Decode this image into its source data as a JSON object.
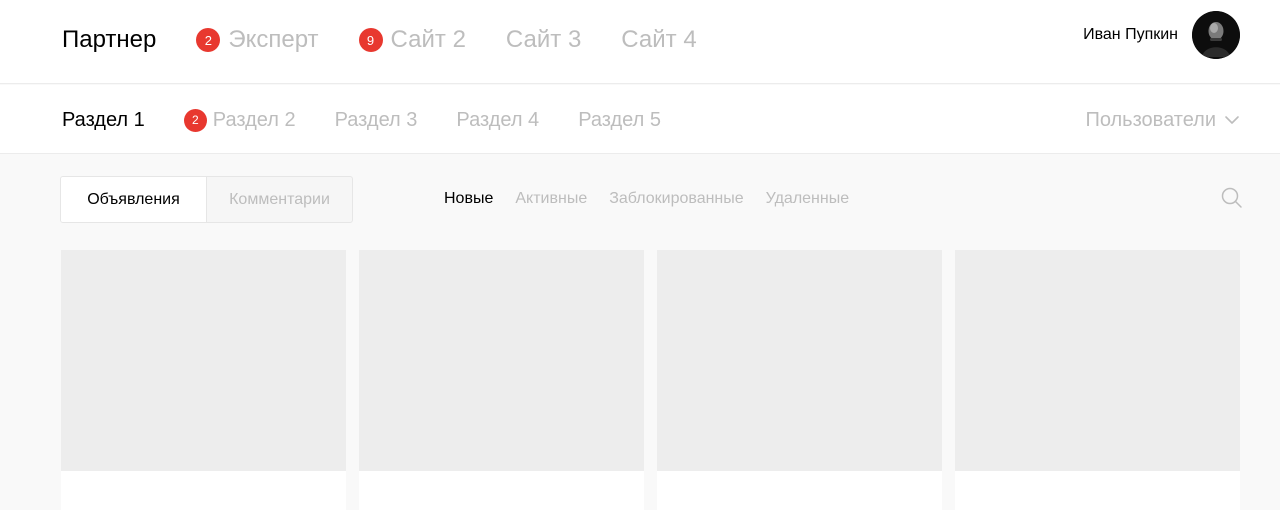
{
  "top_nav": {
    "tabs": [
      {
        "label": "Партнер",
        "badge": "",
        "active": true
      },
      {
        "label": "Эксперт",
        "badge": "2",
        "active": false
      },
      {
        "label": "Сайт 2",
        "badge": "9",
        "active": false
      },
      {
        "label": "Сайт 3",
        "badge": "",
        "active": false
      },
      {
        "label": "Сайт 4",
        "badge": "",
        "active": false
      }
    ]
  },
  "user": {
    "name": "Иван Пупкин"
  },
  "section_nav": {
    "tabs": [
      {
        "label": "Раздел 1",
        "badge": "",
        "active": true
      },
      {
        "label": "Раздел 2",
        "badge": "2",
        "active": false
      },
      {
        "label": "Раздел 3",
        "badge": "",
        "active": false
      },
      {
        "label": "Раздел 4",
        "badge": "",
        "active": false
      },
      {
        "label": "Раздел 5",
        "badge": "",
        "active": false
      }
    ],
    "dropdown_label": "Пользователи"
  },
  "content_type": {
    "options": [
      "Объявления",
      "Комментарии"
    ],
    "selected": "Объявления"
  },
  "status_filters": {
    "items": [
      "Новые",
      "Активные",
      "Заблокированные",
      "Удаленные"
    ],
    "selected": "Новые"
  },
  "colors": {
    "badge": "#e8382f",
    "inactive_text": "#bdbdbd",
    "active_text": "#000000",
    "placeholder": "#ededed"
  },
  "icons": {
    "search": "search-icon",
    "dropdown": "chevron-down-icon"
  }
}
